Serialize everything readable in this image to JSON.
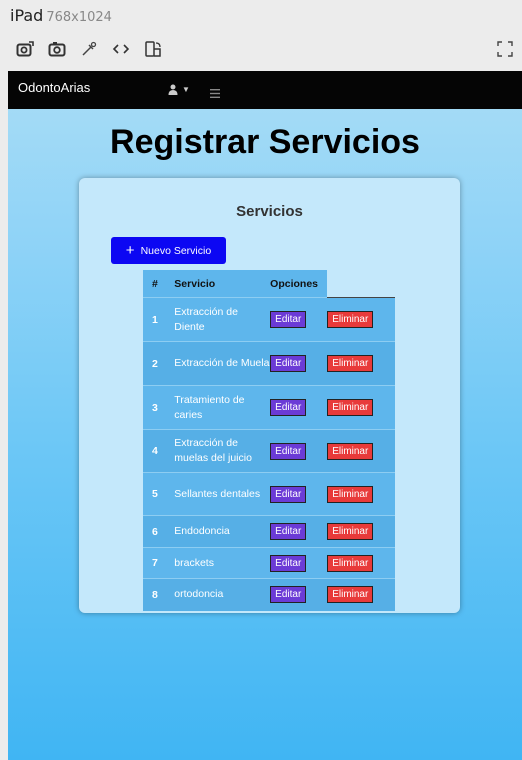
{
  "device": {
    "name": "iPad",
    "size": "768x1024"
  },
  "app": {
    "brand": "OdontoArias",
    "page_title": "Registrar Servicios",
    "card_title": "Servicios",
    "new_button": "Nuevo Servicio",
    "new_button_icon": "+",
    "table": {
      "headers": [
        "#",
        "Servicio",
        "Opciones"
      ],
      "edit_label": "Editar",
      "delete_label": "Eliminar",
      "rows": [
        {
          "num": "1",
          "service": "Extracción de Diente"
        },
        {
          "num": "2",
          "service": "Extracción de Muela"
        },
        {
          "num": "3",
          "service": "Tratamiento de caries"
        },
        {
          "num": "4",
          "service": "Extracción de muelas del juicio"
        },
        {
          "num": "5",
          "service": "Sellantes dentales"
        },
        {
          "num": "6",
          "service": "Endodoncia"
        },
        {
          "num": "7",
          "service": "brackets"
        },
        {
          "num": "8",
          "service": "ortodoncia"
        }
      ]
    }
  },
  "colors": {
    "new_button": "#0c07f3",
    "edit_button": "#6b3bd6",
    "delete_button": "#e83a3a",
    "navbar": "#050505"
  }
}
